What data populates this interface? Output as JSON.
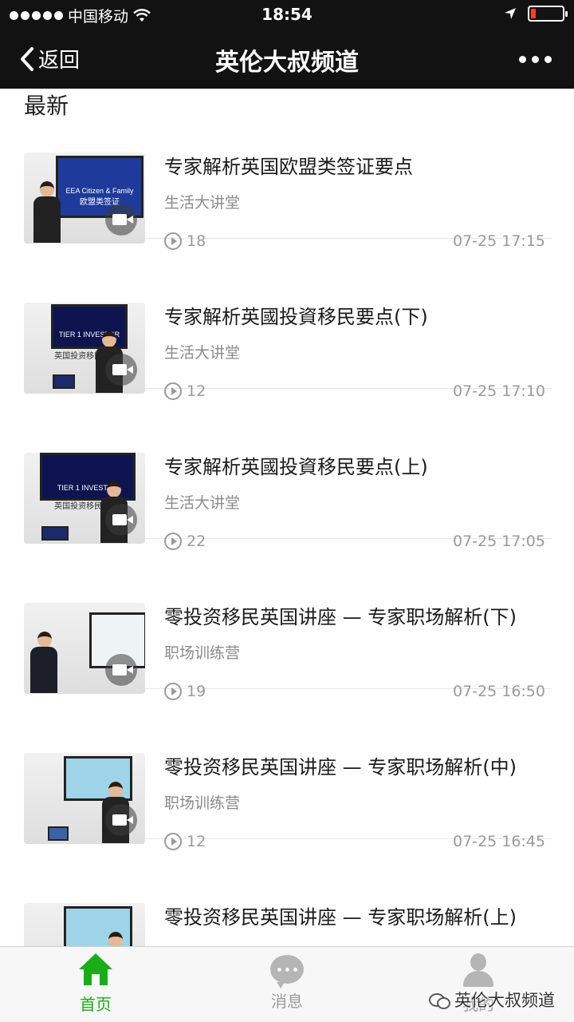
{
  "status_bar": {
    "carrier": "中国移动",
    "time": "18:54",
    "battery_level": 0.15,
    "battery_color": "#ff3b30"
  },
  "nav": {
    "back_label": "返回",
    "title": "英伦大叔频道",
    "more_icon": "more-dots-icon"
  },
  "section_title": "最新",
  "items": [
    {
      "title": "专家解析英国欧盟类签证要点",
      "category": "生活大讲堂",
      "views": "18",
      "time": "07-25 17:15",
      "thumb_text_1": "EEA Citizen & Family",
      "thumb_text_2": "欧盟类签证"
    },
    {
      "title": "专家解析英國投資移民要点(下)",
      "category": "生活大讲堂",
      "views": "12",
      "time": "07-25 17:10",
      "thumb_text_1": "TIER 1 INVESTOR",
      "thumb_text_2": "英国投资移民(下)"
    },
    {
      "title": "专家解析英國投資移民要点(上)",
      "category": "生活大讲堂",
      "views": "22",
      "time": "07-25 17:05",
      "thumb_text_1": "TIER 1 INVESTOR",
      "thumb_text_2": "英国投资移民(上)"
    },
    {
      "title": "零投资移民英国讲座 — 专家职场解析(下)",
      "category": "职场训练营",
      "views": "19",
      "time": "07-25 16:50"
    },
    {
      "title": "零投资移民英国讲座 — 专家职场解析(中)",
      "category": "职场训练营",
      "views": "12",
      "time": "07-25 16:45"
    },
    {
      "title": "零投资移民英国讲座 — 专家职场解析(上)",
      "category": "",
      "views": "",
      "time": ""
    }
  ],
  "tabs": [
    {
      "label": "首页",
      "icon": "home-icon",
      "color": "#1aad19"
    },
    {
      "label": "消息",
      "icon": "chat-icon",
      "color": "#b5b5b5"
    },
    {
      "label": "我的",
      "icon": "user-icon",
      "color": "#b5b5b5"
    }
  ],
  "watermark": "英伦大叔频道"
}
